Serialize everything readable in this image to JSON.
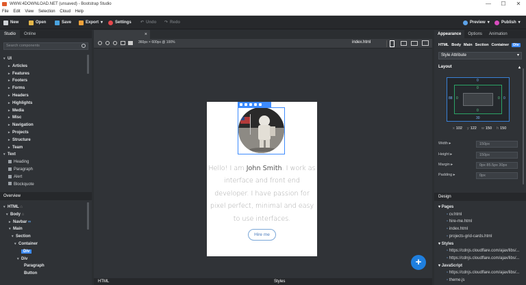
{
  "window": {
    "title": "WWW.4DOWNLOAD.NET (unsaved) - Bootstrap Studio",
    "controls": [
      "—",
      "☐",
      "✕"
    ]
  },
  "menu": [
    "File",
    "Edit",
    "View",
    "Selection",
    "Cloud",
    "Help"
  ],
  "toolbar": {
    "new": "New",
    "open": "Open",
    "save": "Save",
    "export": "Export",
    "settings": "Settings",
    "undo": "Undo",
    "redo": "Redo",
    "preview": "Preview",
    "publish": "Publish"
  },
  "left": {
    "tabs": [
      "Studio",
      "Online"
    ],
    "search_placeholder": "Search components",
    "components": [
      {
        "label": "UI",
        "level": 0,
        "open": true
      },
      {
        "label": "Articles",
        "level": 1
      },
      {
        "label": "Features",
        "level": 1
      },
      {
        "label": "Footers",
        "level": 1
      },
      {
        "label": "Forms",
        "level": 1
      },
      {
        "label": "Headers",
        "level": 1
      },
      {
        "label": "Highlights",
        "level": 1
      },
      {
        "label": "Media",
        "level": 1
      },
      {
        "label": "Misc",
        "level": 1
      },
      {
        "label": "Navigation",
        "level": 1
      },
      {
        "label": "Projects",
        "level": 1
      },
      {
        "label": "Structure",
        "level": 1
      },
      {
        "label": "Team",
        "level": 1
      },
      {
        "label": "Text",
        "level": 0,
        "open": true
      },
      {
        "label": "Heading",
        "level": 2
      },
      {
        "label": "Paragraph",
        "level": 2
      },
      {
        "label": "Alert",
        "level": 2
      },
      {
        "label": "Blockquote",
        "level": 2
      }
    ],
    "overview_title": "Overview",
    "overview": [
      {
        "label": "HTML",
        "level": 0,
        "lock": true
      },
      {
        "label": "Body",
        "level": 1,
        "lock": true
      },
      {
        "label": "Navbar",
        "level": 2,
        "link": true
      },
      {
        "label": "Main",
        "level": 2
      },
      {
        "label": "Section",
        "level": 3
      },
      {
        "label": "Container",
        "level": 4
      },
      {
        "label": "Div",
        "level": 5,
        "selected": true
      },
      {
        "label": "Div",
        "level": 5
      },
      {
        "label": "Paragraph",
        "level": 6
      },
      {
        "label": "Button",
        "level": 6
      }
    ]
  },
  "canvas": {
    "viewport": "360px × 600px @ 100%",
    "file": "index.html",
    "bio_pre": "Hello! I am ",
    "bio_name": "John Smith",
    "bio_post": ". I work as interface and front end developer. I have passion for pixel perfect, minimal and easy to use interfaces.",
    "hire": "Hire me",
    "fab": "+",
    "bottom_left": "HTML",
    "bottom_mid": "Styles"
  },
  "right": {
    "tabs": [
      "Appearance",
      "Options",
      "Animation"
    ],
    "crumbs": [
      "HTML",
      "Body",
      "Main",
      "Section",
      "Container",
      "Div"
    ],
    "style_attr": "Style Attribute",
    "layout": "Layout",
    "box": {
      "margin": "0",
      "border": "0",
      "left": "88",
      "right": "30",
      "inner_top": "0",
      "inner_bottom": "0",
      "inner_left": "0",
      "inner_right": "0"
    },
    "dims": [
      {
        "k": "x",
        "v": "102"
      },
      {
        "k": "y",
        "v": "122"
      },
      {
        "k": "w",
        "v": "150"
      },
      {
        "k": "h",
        "v": "150"
      }
    ],
    "props": [
      {
        "k": "Width",
        "v": "150px"
      },
      {
        "k": "Height",
        "v": "150px"
      },
      {
        "k": "Margin",
        "v": "0px 85.5px 30px"
      },
      {
        "k": "Padding",
        "v": "0px"
      }
    ],
    "design_title": "Design",
    "design": [
      {
        "group": "Pages"
      },
      {
        "item": "cv.html"
      },
      {
        "item": "hire-me.html"
      },
      {
        "item": "index.html"
      },
      {
        "item": "projects-grid-cards.html"
      },
      {
        "group": "Styles"
      },
      {
        "item": "https://cdnjs.cloudflare.com/ajax/libs/..."
      },
      {
        "item": "https://cdnjs.cloudflare.com/ajax/libs/..."
      },
      {
        "group": "JavaScript"
      },
      {
        "item": "https://cdnjs.cloudflare.com/ajax/libs/..."
      },
      {
        "item": "theme.js"
      }
    ]
  },
  "colors": {
    "accent": "#3d8bfd",
    "fab": "#1f7fde",
    "export": "#f0a23a",
    "settings": "#e5484d",
    "publish": "#d84cbe"
  }
}
